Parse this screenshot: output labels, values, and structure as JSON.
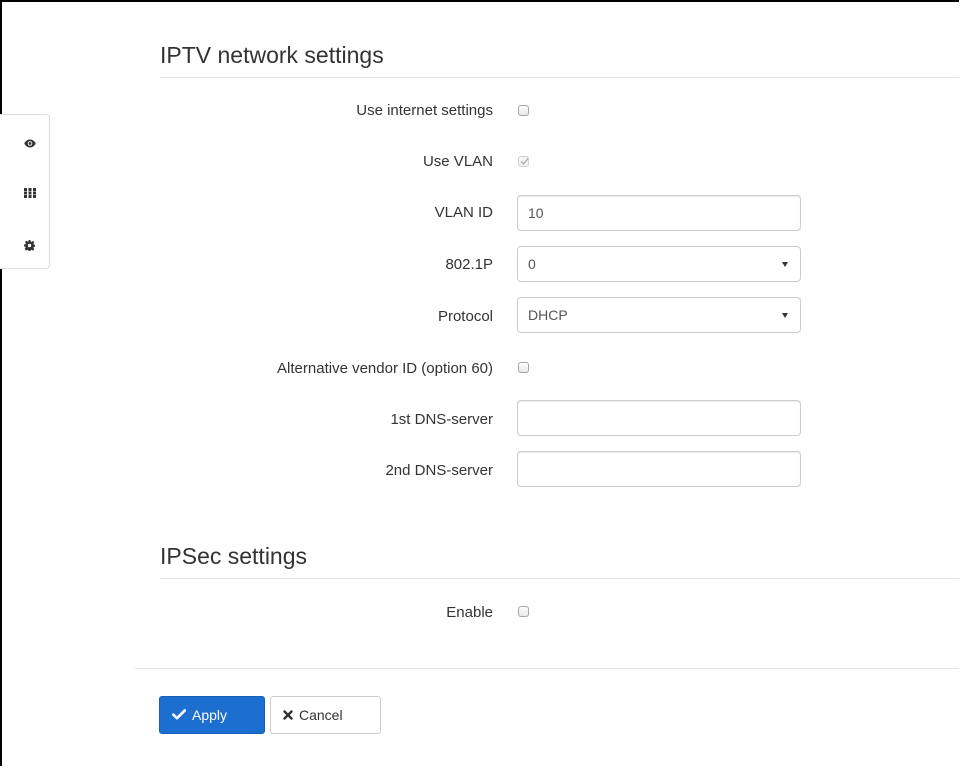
{
  "sidebar": {
    "items": [
      {
        "icon": "eye-icon"
      },
      {
        "icon": "grid-icon"
      },
      {
        "icon": "gear-icon"
      }
    ]
  },
  "iptv": {
    "title": "IPTV network settings",
    "use_internet_settings": {
      "label": "Use internet settings",
      "checked": false
    },
    "use_vlan": {
      "label": "Use VLAN",
      "checked": true,
      "disabled": true
    },
    "vlan_id": {
      "label": "VLAN ID",
      "value": "10"
    },
    "p8021": {
      "label": "802.1P",
      "selected": "0"
    },
    "protocol": {
      "label": "Protocol",
      "selected": "DHCP"
    },
    "alt_vendor": {
      "label": "Alternative vendor ID (option 60)",
      "checked": false
    },
    "dns1": {
      "label": "1st DNS-server",
      "value": ""
    },
    "dns2": {
      "label": "2nd DNS-server",
      "value": ""
    }
  },
  "ipsec": {
    "title": "IPSec settings",
    "enable": {
      "label": "Enable",
      "checked": false
    }
  },
  "actions": {
    "apply_label": "Apply",
    "cancel_label": "Cancel"
  },
  "colors": {
    "primary": "#1c6fd0",
    "text": "#333333",
    "border": "#cccccc"
  }
}
